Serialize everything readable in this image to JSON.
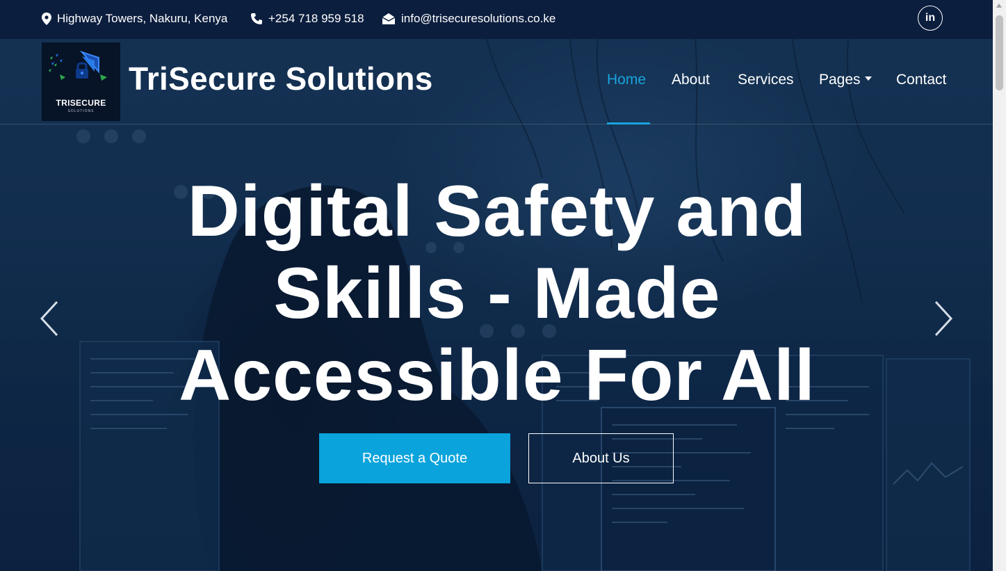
{
  "topbar": {
    "address": "Highway Towers, Nakuru, Kenya",
    "phone": "+254 718 959 518",
    "email": "info@trisecuresolutions.co.ke",
    "social_label": "in"
  },
  "brand": {
    "logo_text": "TRISECURE",
    "logo_subtext": "SOLUTIONS",
    "name": "TriSecure Solutions"
  },
  "nav": {
    "items": [
      {
        "label": "Home",
        "active": true
      },
      {
        "label": "About"
      },
      {
        "label": "Services"
      },
      {
        "label": "Pages",
        "has_dropdown": true
      },
      {
        "label": "Contact"
      }
    ]
  },
  "hero": {
    "headline_line1": "Digital Safety and",
    "headline_line2": "Skills - Made",
    "headline_line3": "Accessible For All",
    "primary_button": "Request a Quote",
    "secondary_button": "About Us"
  },
  "colors": {
    "accent": "#0aa3dc",
    "topbar_bg": "#0c1e3e",
    "hero_overlay": "#10294a"
  }
}
